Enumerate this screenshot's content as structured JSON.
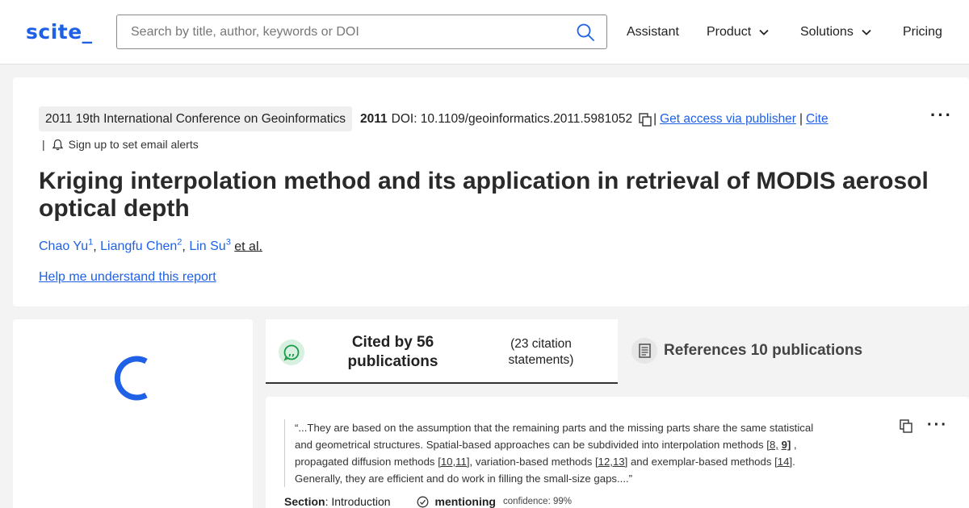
{
  "nav": {
    "logo": "scite_",
    "search_placeholder": "Search by title, author, keywords or DOI",
    "items": [
      {
        "label": "Assistant"
      },
      {
        "label": "Product"
      },
      {
        "label": "Solutions"
      },
      {
        "label": "Pricing"
      }
    ]
  },
  "paper": {
    "venue": "2011 19th International Conference on Geoinformatics",
    "year": "2011",
    "doi": "DOI: 10.1109/geoinformatics.2011.5981052",
    "separator": "|",
    "access_link": "Get access via publisher",
    "cite_link": "Cite",
    "alerts_label": "Sign up to set email alerts",
    "more_label": "···",
    "title": "Kriging interpolation method and its application in retrieval of MODIS aerosol optical depth",
    "authors": [
      {
        "name": "Chao Yu",
        "sup": "1"
      },
      {
        "name": "Liangfu Chen",
        "sup": "2"
      },
      {
        "name": "Lin Su",
        "sup": "3"
      }
    ],
    "author_sep": ", ",
    "et_al": "et al.",
    "help_link": "Help me understand this report"
  },
  "tabs": {
    "cited_main": "Cited by 56 publications",
    "cited_sub": "(23 citation statements)",
    "refs_label": "References 10 publications"
  },
  "citation": {
    "quote_1": "“...They are based on the assumption that the remaining parts and the missing parts share the same statistical and geometrical structures. Spatial-based approaches can be subdivided into interpolation methods ",
    "ref_1a": "[8,",
    "ref_1b": "9]",
    "quote_2": " , propagated diffusion methods ",
    "ref_2": "[10,11]",
    "quote_3": ", variation-based methods ",
    "ref_3": "[12,13]",
    "quote_4": " and exemplar-based methods ",
    "ref_4": "[14]",
    "quote_5": ". Generally, they are efficient and do work in filling the small-size gaps....”",
    "section_label": "Section",
    "section_value": ": Introduction",
    "classification": "mentioning",
    "confidence": "confidence: 99%",
    "more_label": "···"
  },
  "colors": {
    "brand": "#1f61e6",
    "page_bg": "#f3f3f3",
    "mention_green": "#1a9a4a"
  },
  "icons": [
    "search-icon",
    "chevron-down-icon",
    "copy-icon",
    "bell-icon",
    "more-icon",
    "loading-spinner-icon",
    "chat-bubble-icon",
    "document-icon",
    "check-circle-icon"
  ]
}
